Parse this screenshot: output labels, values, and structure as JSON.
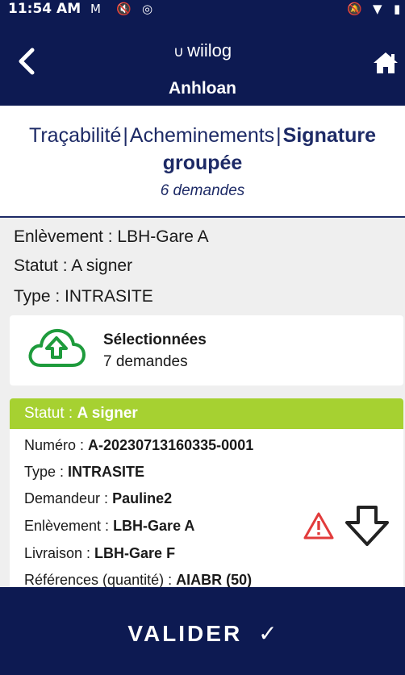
{
  "status_bar": {
    "time": "11:54 AM"
  },
  "header": {
    "logo_text": "wiilog",
    "title": "Anhloan"
  },
  "breadcrumb": {
    "item1": "Traçabilité",
    "item2": "Acheminements",
    "separator": "|",
    "current": "Signature groupée",
    "subtitle": "6 demandes"
  },
  "info": {
    "pickup": "Enlèvement : LBH-Gare A",
    "status": "Statut : A signer",
    "type": "Type : INTRASITE"
  },
  "selection": {
    "title": "Sélectionnées",
    "count": "7 demandes"
  },
  "request": {
    "status_label": "Statut : ",
    "status_value": "A signer",
    "numero_label": "Numéro : ",
    "numero": "A-20230713160335-0001",
    "type_label": "Type : ",
    "type": "INTRASITE",
    "demandeur_label": "Demandeur : ",
    "demandeur": "Pauline2",
    "enlevement_label": "Enlèvement : ",
    "enlevement": "LBH-Gare A",
    "livraison_label": "Livraison : ",
    "livraison": "LBH-Gare F",
    "references_label": "Références (quantité) : ",
    "references": "AIABR (50)"
  },
  "footer": {
    "validate_label": "VALIDER",
    "check_glyph": "✓"
  },
  "colors": {
    "primary": "#0d1a52",
    "accent_green": "#a6d131",
    "icon_green": "#1e9b3c",
    "warning_red": "#e23b3b"
  }
}
